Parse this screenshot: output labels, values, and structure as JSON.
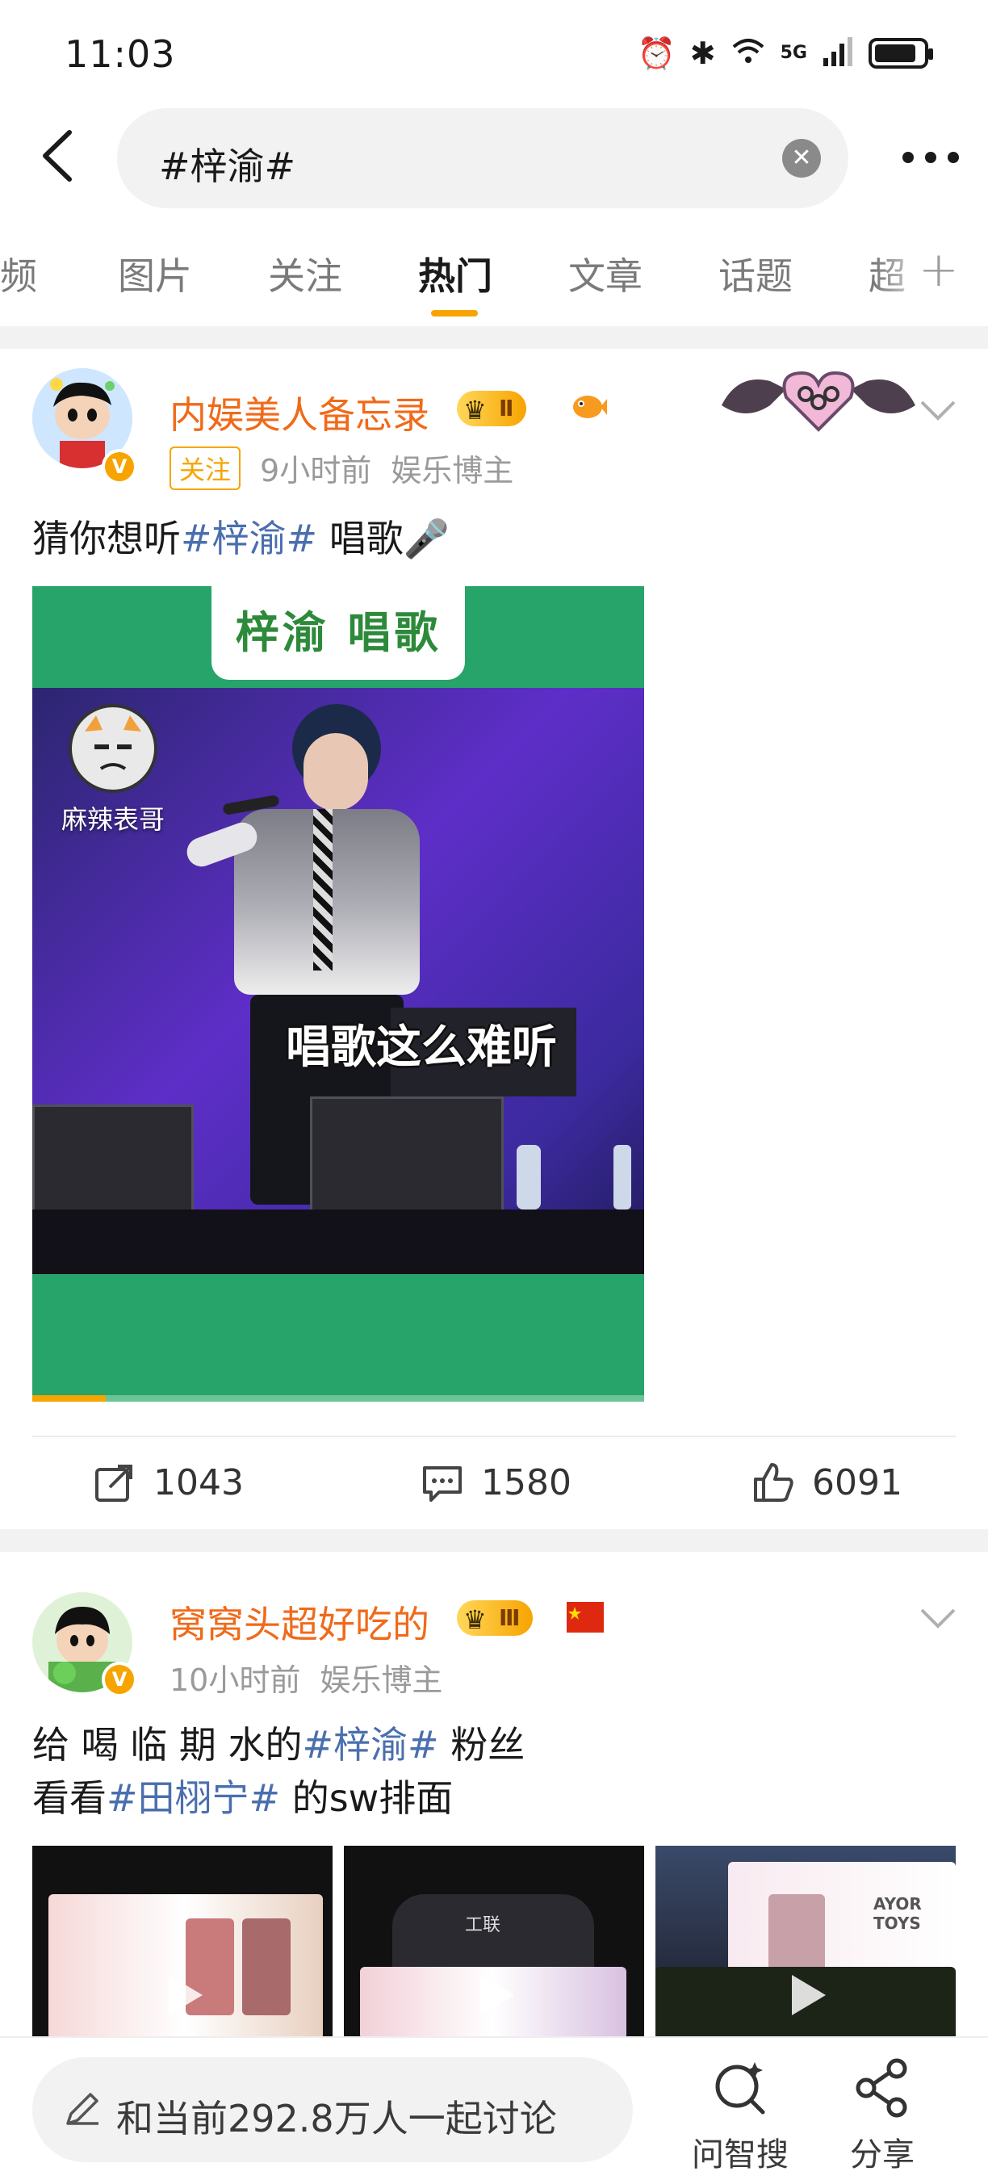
{
  "status_bar": {
    "time": "11:03",
    "network": "5G"
  },
  "search": {
    "query": "#梓渝#"
  },
  "tabs": [
    "视频",
    "图片",
    "关注",
    "热门",
    "文章",
    "话题",
    "超"
  ],
  "active_tab": "热门",
  "posts": [
    {
      "author": "内娱美人备忘录",
      "level": "Ⅱ",
      "follow_label": "关注",
      "time": "9小时前",
      "role": "娱乐博主",
      "text_before": "猜你想听",
      "topic": "#梓渝#",
      "text_after": " 唱歌🎤",
      "video": {
        "title": "梓渝 唱歌",
        "watermark": "麻辣表哥",
        "subtitle": "唱歌这么难听",
        "progress": 0.12
      },
      "actions": {
        "reposts": "1043",
        "comments": "1580",
        "likes": "6091"
      }
    },
    {
      "author": "窝窝头超好吃的",
      "level": "Ⅲ",
      "time": "10小时前",
      "role": "娱乐博主",
      "line1_before": "给 喝 临 期 水的",
      "line1_topic": "#梓渝#",
      "line1_after": " 粉丝",
      "line2_before": "看看",
      "line2_topic": "#田栩宁#",
      "line2_after": " 的sw排面",
      "thumb_texts": [
        "工联",
        "AYOR TOYS"
      ]
    }
  ],
  "bottom_bar": {
    "discuss_placeholder": "和当前292.8万人一起讨论",
    "ai_search_label": "问智搜",
    "share_label": "分享"
  },
  "colors": {
    "accent": "#f7a400",
    "topic": "#4a6fae",
    "author": "#f06a1a",
    "video_bg": "#26a46a"
  }
}
